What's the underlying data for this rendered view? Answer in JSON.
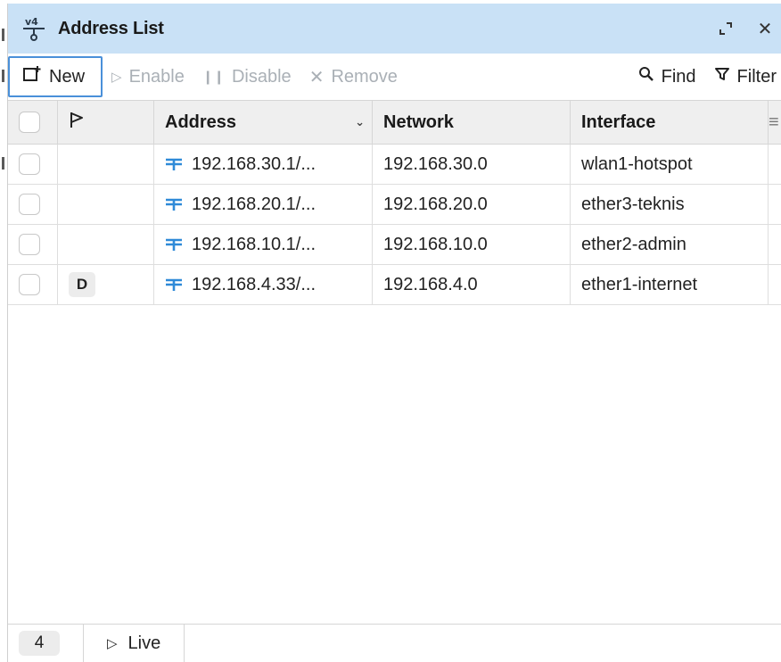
{
  "window": {
    "title": "Address List",
    "icon": "ipv4-address-icon",
    "actions": [
      "restore-icon",
      "close-icon"
    ]
  },
  "toolbar": {
    "new_label": "New",
    "enable_label": "Enable",
    "disable_label": "Disable",
    "remove_label": "Remove",
    "find_label": "Find",
    "filter_label": "Filter"
  },
  "table": {
    "columns": {
      "address": "Address",
      "network": "Network",
      "interface": "Interface"
    },
    "rows": [
      {
        "flag": "",
        "address": "192.168.30.1/...",
        "network": "192.168.30.0",
        "interface": "wlan1-hotspot"
      },
      {
        "flag": "",
        "address": "192.168.20.1/...",
        "network": "192.168.20.0",
        "interface": "ether3-teknis"
      },
      {
        "flag": "",
        "address": "192.168.10.1/...",
        "network": "192.168.10.0",
        "interface": "ether2-admin"
      },
      {
        "flag": "D",
        "address": "192.168.4.33/...",
        "network": "192.168.4.0",
        "interface": "ether1-internet"
      }
    ]
  },
  "status": {
    "count": "4",
    "live_label": "Live"
  },
  "colors": {
    "titlebar": "#c9e1f6",
    "accent": "#4a90d9",
    "address_icon": "#2f8ad8"
  }
}
